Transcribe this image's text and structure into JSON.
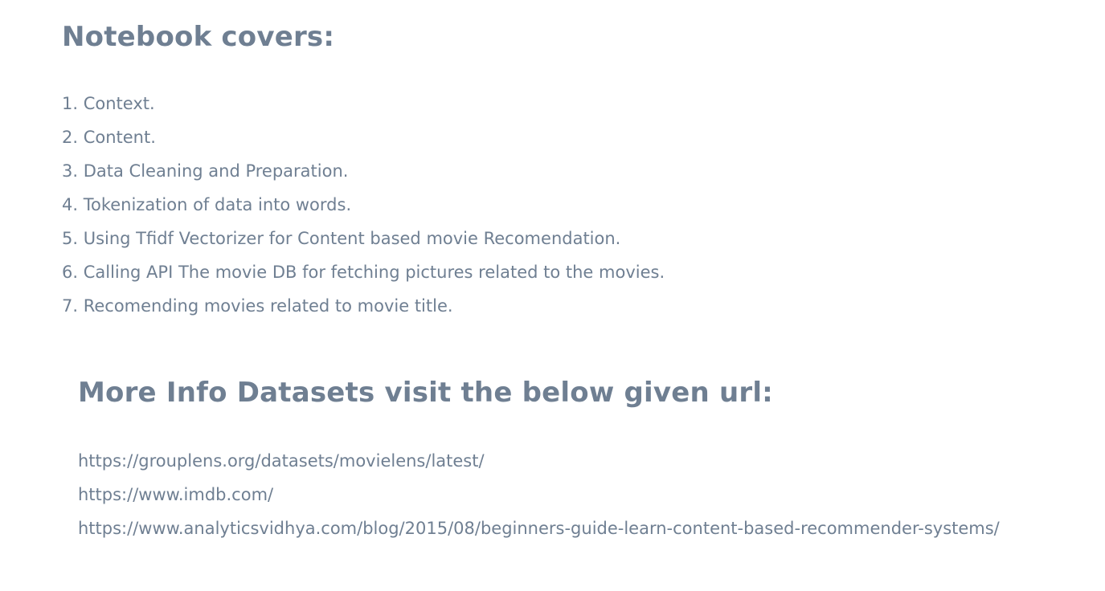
{
  "notebook": {
    "heading": "Notebook covers:",
    "items": [
      "1. Context.",
      "2. Content.",
      "3. Data Cleaning and Preparation.",
      "4. Tokenization of data into words.",
      "5. Using Tfidf Vectorizer for Content based movie Recomendation.",
      "6. Calling API The movie DB for fetching pictures related to the movies.",
      "7. Recomending movies related to movie title."
    ]
  },
  "more_info": {
    "heading": "More Info Datasets visit the below given url:",
    "urls": [
      "https://grouplens.org/datasets/movielens/latest/",
      "https://www.imdb.com/",
      "https://www.analyticsvidhya.com/blog/2015/08/beginners-guide-learn-content-based-recommender-systems/"
    ]
  }
}
